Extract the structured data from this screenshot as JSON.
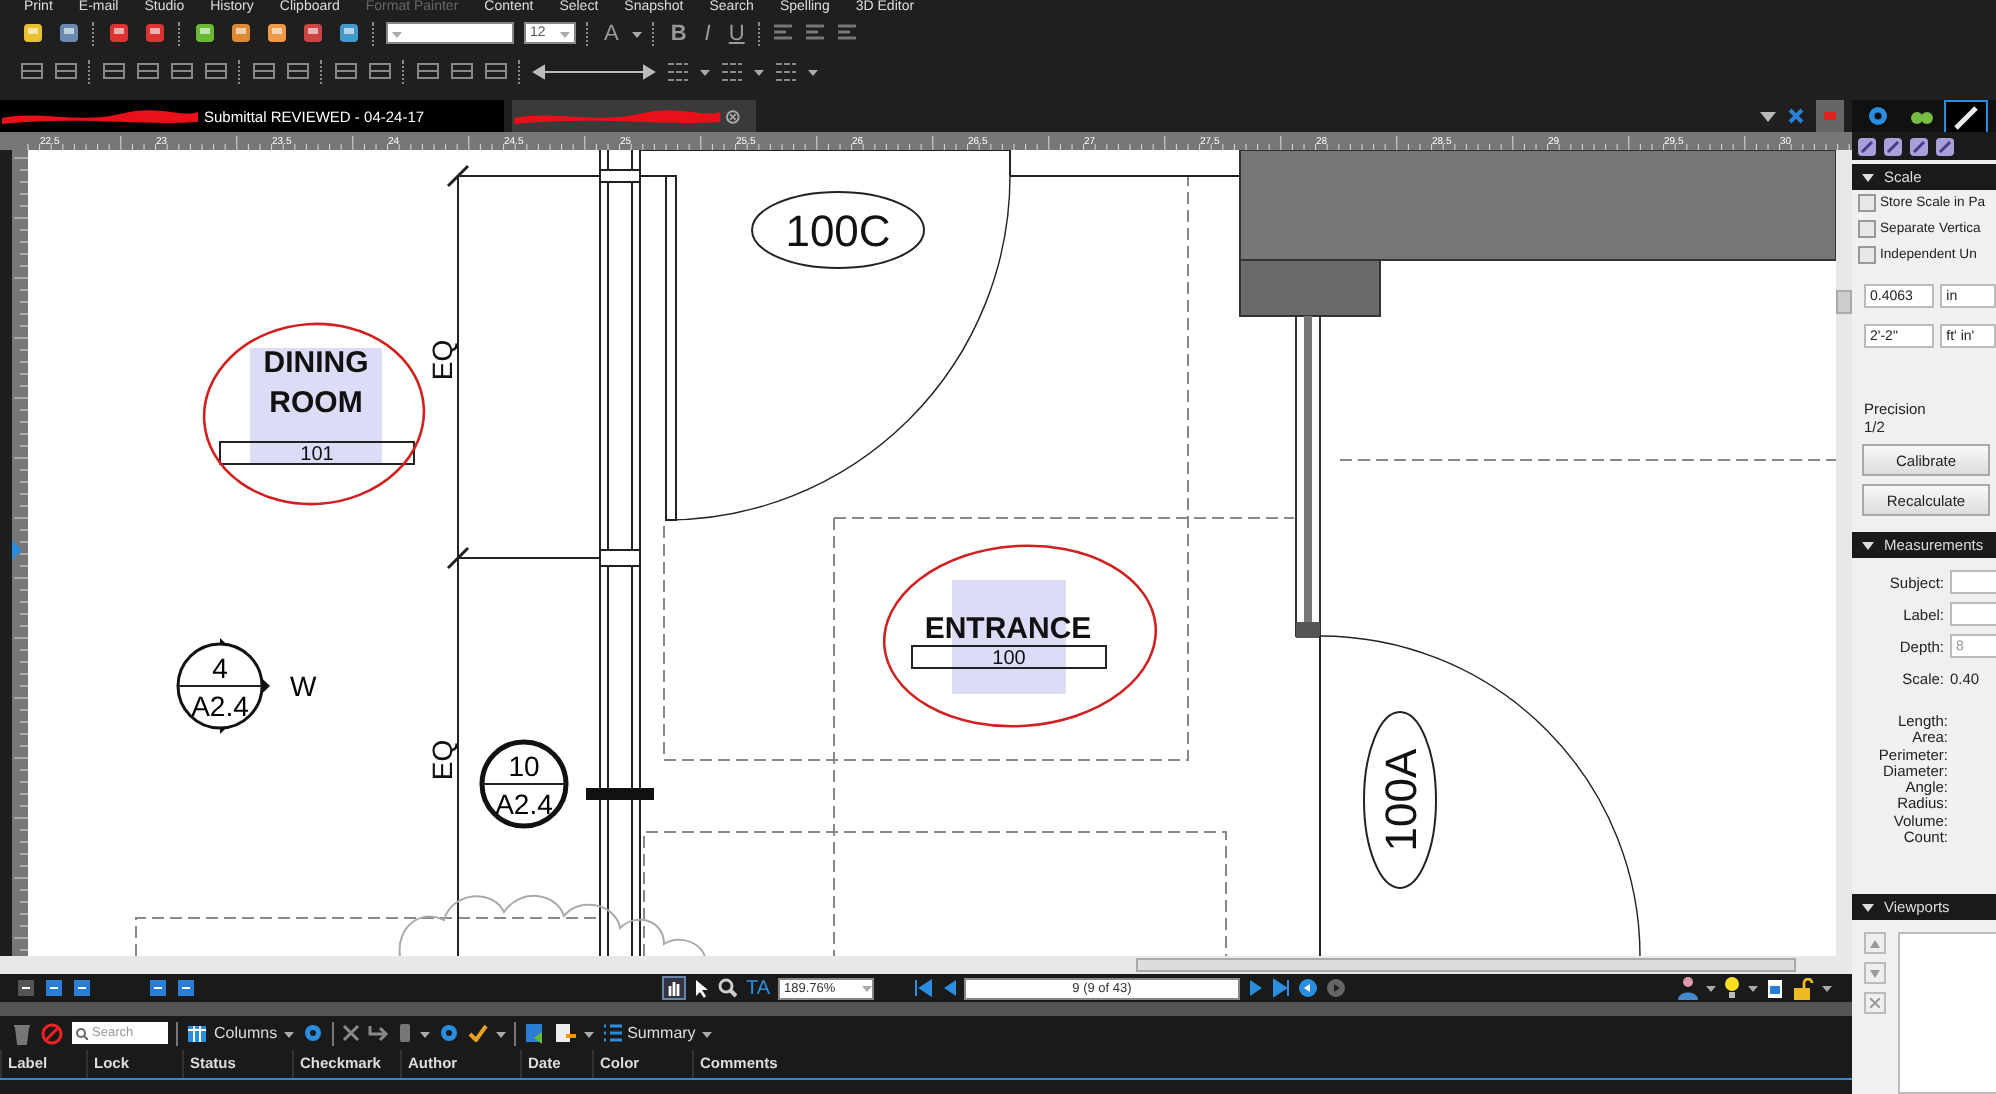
{
  "menu": [
    {
      "label": "Print",
      "disabled": false
    },
    {
      "label": "E-mail",
      "disabled": false
    },
    {
      "label": "Studio",
      "disabled": false
    },
    {
      "label": "History",
      "disabled": false
    },
    {
      "label": "Clipboard",
      "disabled": false
    },
    {
      "label": "Format Painter",
      "disabled": true
    },
    {
      "label": "Content",
      "disabled": false
    },
    {
      "label": "Select",
      "disabled": false
    },
    {
      "label": "Snapshot",
      "disabled": false
    },
    {
      "label": "Search",
      "disabled": false
    },
    {
      "label": "Spelling",
      "disabled": false
    },
    {
      "label": "3D Editor",
      "disabled": false
    }
  ],
  "format_toolbar": {
    "font_size": "12",
    "text_buttons": [
      {
        "label": "A",
        "kind": "color"
      },
      {
        "label": "B",
        "kind": "bold"
      },
      {
        "label": "I",
        "kind": "italic"
      },
      {
        "label": "U",
        "kind": "underline"
      }
    ]
  },
  "tabs": [
    {
      "label": "Submittal REVIEWED - 04-24-17",
      "selected": true
    },
    {
      "selected": false
    }
  ],
  "ruler": {
    "ticks": [
      "22.5",
      "23",
      "23.5",
      "24",
      "24.5",
      "25",
      "25.5",
      "26",
      "26.5",
      "27",
      "27.5",
      "28",
      "28.5",
      "29",
      "29.5",
      "30"
    ]
  },
  "drawing": {
    "door_tags": [
      {
        "label": "100C",
        "kind": "horizontal"
      },
      {
        "label": "100A",
        "kind": "vertical"
      }
    ],
    "rooms": [
      {
        "name": "DINING ROOM",
        "number": "101"
      },
      {
        "name": "ENTRANCE",
        "number": "100"
      }
    ],
    "dimension_labels": [
      "EQ",
      "EQ"
    ],
    "section_mark": {
      "number": "4",
      "sheet": "A2.4",
      "direction": "W"
    },
    "detail_mark": {
      "number": "10",
      "sheet": "A2.4"
    }
  },
  "navigation": {
    "text_tool": "TA",
    "zoom": "189.76%",
    "page": "9 (9 of 43)"
  },
  "markups": {
    "search_placeholder": "Search",
    "columns_button": "Columns",
    "summary_button": "Summary",
    "columns": [
      "Label",
      "Lock",
      "Status",
      "Checkmark",
      "Author",
      "Date",
      "Color",
      "Comments"
    ]
  },
  "side_panel": {
    "tabs": [
      {
        "kind": "gear",
        "selected": false
      },
      {
        "kind": "binoculars",
        "selected": false
      },
      {
        "kind": "ruler",
        "selected": true
      }
    ],
    "scale": {
      "title": "Scale",
      "expanded": true,
      "options": [
        {
          "label": "Store Scale in Pa",
          "checked": false
        },
        {
          "label": "Separate Vertica",
          "checked": false
        },
        {
          "label": "Independent Un",
          "checked": false
        }
      ],
      "document_value": "0.4063",
      "document_unit": "in",
      "real_value": "2'-2\"",
      "real_unit": "ft' in'",
      "precision_label": "Precision",
      "precision": "1/2",
      "buttons": [
        "Calibrate",
        "Recalculate"
      ]
    },
    "measurements": {
      "title": "Measurements",
      "expanded": true,
      "fields": [
        {
          "label": "Subject:",
          "kind": "input",
          "disabled": false
        },
        {
          "label": "Label:",
          "kind": "input",
          "disabled": false
        },
        {
          "label": "Depth:",
          "kind": "input",
          "value": "8",
          "disabled": true
        },
        {
          "label": "Scale:",
          "kind": "text",
          "value": "0.40"
        }
      ],
      "results": [
        "Length:",
        "Area:",
        "Perimeter:",
        "Diameter:",
        "Angle:",
        "Radius:",
        "Volume:",
        "Count:"
      ]
    },
    "viewports": {
      "title": "Viewports",
      "expanded": true
    }
  }
}
